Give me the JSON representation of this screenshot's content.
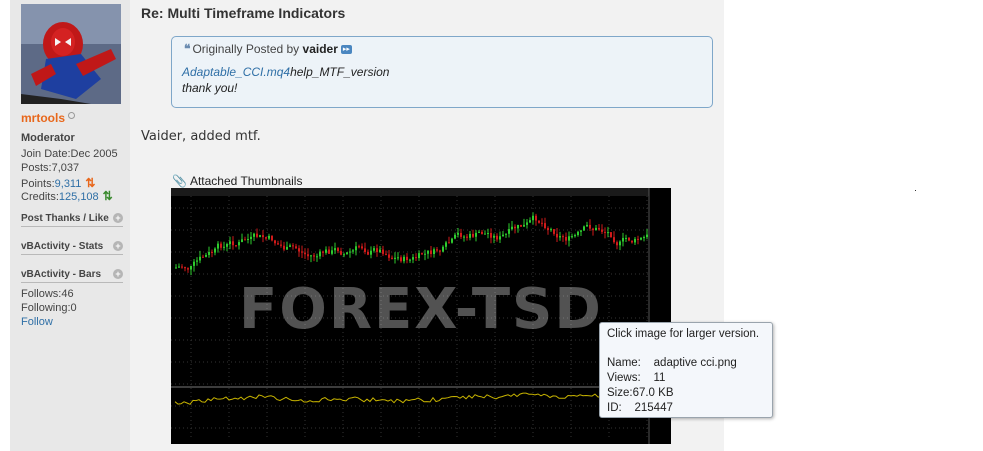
{
  "post": {
    "title": "Re: Multi Timeframe Indicators",
    "message": "Vaider, added mtf."
  },
  "user": {
    "name": "mrtools",
    "role": "Moderator",
    "join_label": "Join Date:",
    "join_value": "Dec 2005",
    "posts_label": "Posts:",
    "posts_value": "7,037",
    "points_label": "Points:",
    "points_value": "9,311",
    "credits_label": "Credits:",
    "credits_value": "125,108"
  },
  "sidebar": {
    "post_thanks": "Post Thanks / Like",
    "vb_stats": "vBActivity - Stats",
    "vb_bars": "vBActivity - Bars",
    "follows": "Follows:46",
    "following": "Following:0",
    "follow_link": "Follow"
  },
  "quote": {
    "prefix": "Originally Posted by",
    "author": "vaider",
    "link_text": "Adaptable_CCI.mq4",
    "link_rest": "help_MTF_version",
    "line2": "thank you!"
  },
  "attachments": {
    "heading": "Attached Thumbnails",
    "watermark": "FOREX-TSD"
  },
  "tooltip": {
    "line1": "Click image for larger version.",
    "name_label": "Name:",
    "name_value": "adaptive cci.png",
    "views_label": "Views:",
    "views_value": "11",
    "size_line": "Size:67.0 KB",
    "id_label": "ID:",
    "id_value": "215447"
  },
  "colors": {
    "username": "#e8671b",
    "link": "#2f6fa6",
    "quote_border": "#7fa7c9",
    "chart_bull": "#2ecc2e",
    "chart_bear": "#d11a1a",
    "chart_cci": "#c8b400"
  }
}
